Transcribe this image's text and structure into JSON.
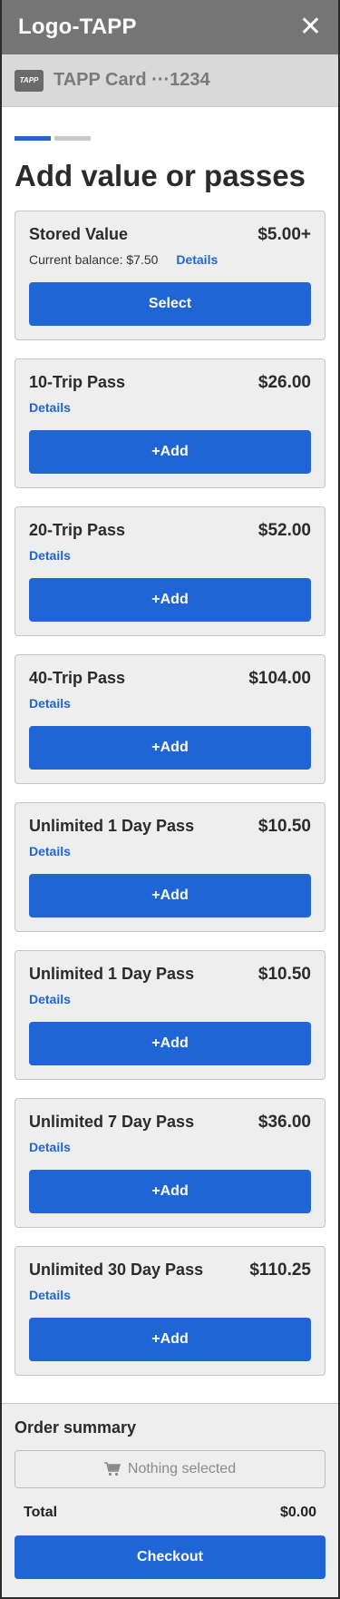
{
  "header": {
    "logo": "Logo-TAPP",
    "close_symbol": "✕"
  },
  "card": {
    "icon_text": "TAPP",
    "name": "TAPP Card ···1234"
  },
  "progress": {
    "steps": 2,
    "current": 1
  },
  "page": {
    "title": "Add value or passes"
  },
  "items": [
    {
      "name": "Stored Value",
      "price": "$5.00+",
      "balance": "Current balance: $7.50",
      "details": "Details",
      "button": "Select"
    },
    {
      "name": "10-Trip Pass",
      "price": "$26.00",
      "details": "Details",
      "button": "+Add"
    },
    {
      "name": "20-Trip Pass",
      "price": "$52.00",
      "details": "Details",
      "button": "+Add"
    },
    {
      "name": "40-Trip Pass",
      "price": "$104.00",
      "details": "Details",
      "button": "+Add"
    },
    {
      "name": "Unlimited 1 Day Pass",
      "price": "$10.50",
      "details": "Details",
      "button": "+Add"
    },
    {
      "name": "Unlimited 1 Day Pass",
      "price": "$10.50",
      "details": "Details",
      "button": "+Add"
    },
    {
      "name": "Unlimited 7 Day Pass",
      "price": "$36.00",
      "details": "Details",
      "button": "+Add"
    },
    {
      "name": "Unlimited 30 Day Pass",
      "price": "$110.25",
      "details": "Details",
      "button": "+Add"
    }
  ],
  "summary": {
    "title": "Order summary",
    "empty_text": "Nothing selected",
    "total_label": "Total",
    "total_value": "$0.00",
    "checkout_label": "Checkout"
  },
  "colors": {
    "accent": "#1f65d6",
    "header_bg": "#757575",
    "card_bar_bg": "#d9d9d9",
    "panel_bg": "#eeeeee"
  }
}
